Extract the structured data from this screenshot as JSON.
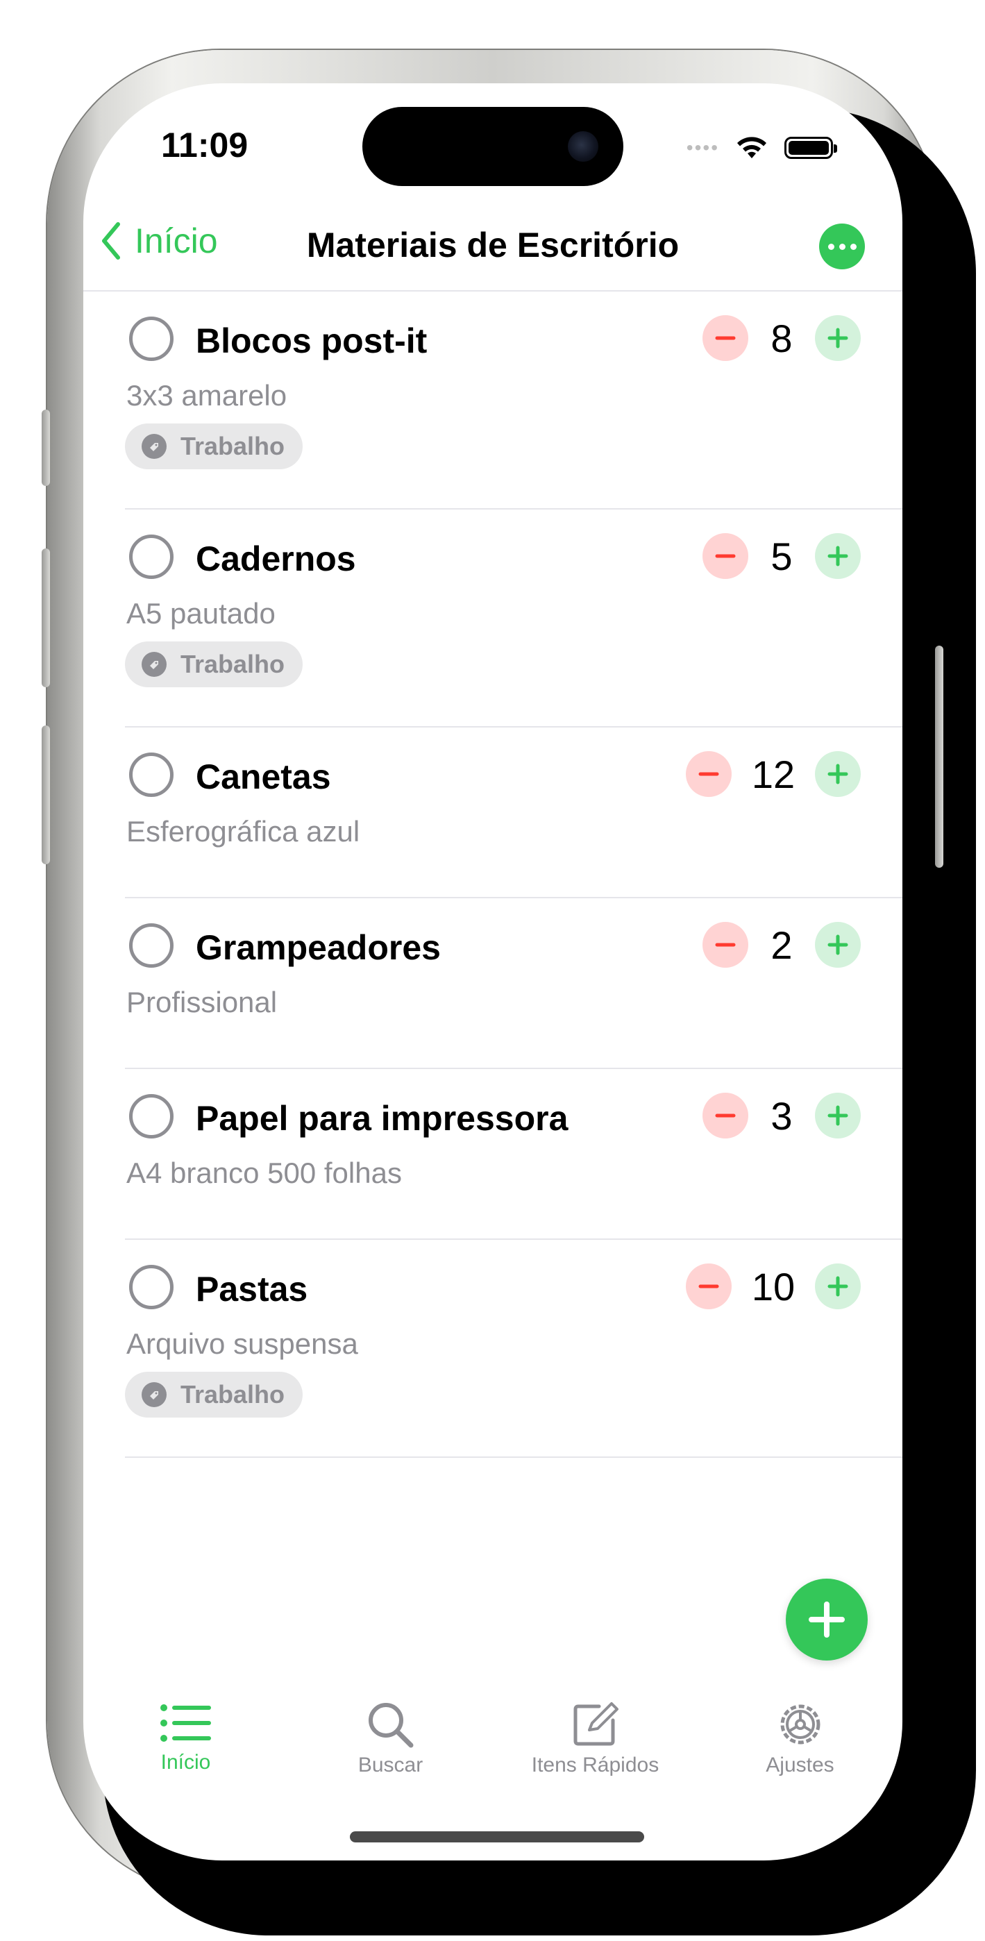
{
  "status": {
    "time": "11:09",
    "signal": "••••"
  },
  "nav": {
    "back_label": "Início",
    "title": "Materiais de Escritório"
  },
  "items": [
    {
      "name": "Blocos post-it",
      "note": "3x3 amarelo",
      "quantity": "8",
      "tag": "Trabalho"
    },
    {
      "name": "Cadernos",
      "note": "A5 pautado",
      "quantity": "5",
      "tag": "Trabalho"
    },
    {
      "name": "Canetas",
      "note": "Esferográfica azul",
      "quantity": "12",
      "tag": ""
    },
    {
      "name": "Grampeadores",
      "note": "Profissional",
      "quantity": "2",
      "tag": ""
    },
    {
      "name": "Papel para impressora",
      "note": "A4 branco 500 folhas",
      "quantity": "3",
      "tag": ""
    },
    {
      "name": "Pastas",
      "note": "Arquivo suspensa",
      "quantity": "10",
      "tag": "Trabalho"
    }
  ],
  "tabs": [
    {
      "label": "Início",
      "icon": "list-icon",
      "active": true
    },
    {
      "label": "Buscar",
      "icon": "search-icon",
      "active": false
    },
    {
      "label": "Itens Rápidos",
      "icon": "compose-icon",
      "active": false
    },
    {
      "label": "Ajustes",
      "icon": "gear-icon",
      "active": false
    }
  ],
  "colors": {
    "accent": "#34c759",
    "minus_bg": "#ffd3d3",
    "minus_fg": "#ff3b30",
    "plus_bg": "#d4f2dc",
    "secondary_text": "#8e8e93"
  }
}
